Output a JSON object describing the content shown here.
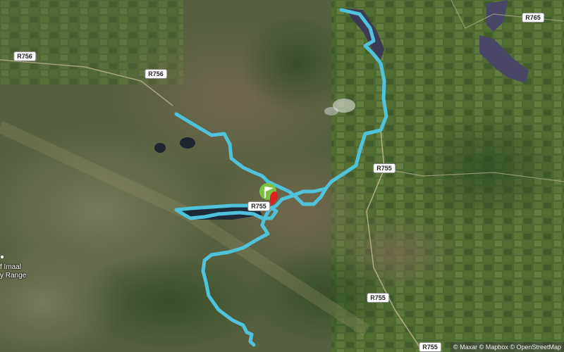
{
  "map": {
    "road_labels": [
      "R756",
      "R756",
      "R765",
      "R755",
      "R755",
      "R755",
      "R755"
    ],
    "place_label_lines": [
      "f Imaal",
      "y Range"
    ],
    "attribution": "© Maxar © Mapbox © OpenStreetMap",
    "route_color": "#4fc3dc",
    "start_marker_color": "#7cc242",
    "end_marker_color": "#e02020"
  },
  "icons": {
    "start": "start-flag-icon",
    "end": "finish-pin-icon"
  }
}
